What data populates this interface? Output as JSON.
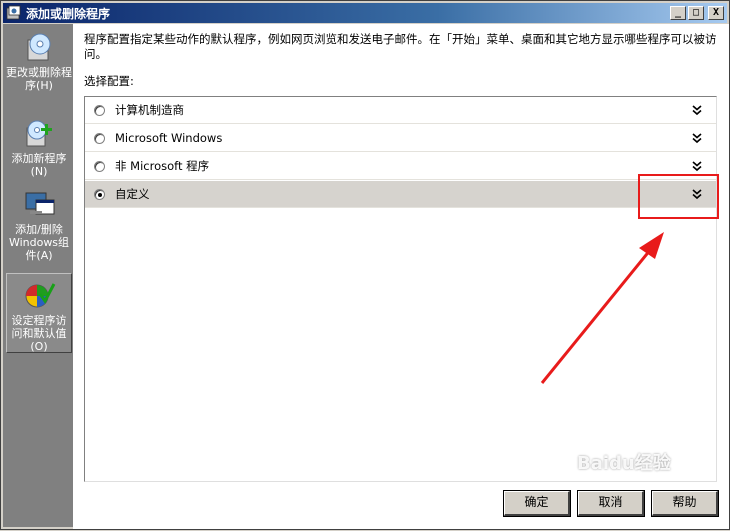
{
  "window": {
    "title": "添加或删除程序",
    "buttons": {
      "minimize": "_",
      "maximize": "□",
      "close": "X"
    }
  },
  "sidebar": {
    "items": [
      {
        "label": "更改或删除程序(H)",
        "icon": "cd-box-icon",
        "active": false
      },
      {
        "label": "添加新程序(N)",
        "icon": "add-program-icon",
        "active": false
      },
      {
        "label": "添加/删除Windows组件(A)",
        "icon": "windows-components-icon",
        "active": false
      },
      {
        "label": "设定程序访问和默认值(O)",
        "icon": "defaults-check-icon",
        "active": true
      }
    ]
  },
  "main": {
    "description": "程序配置指定某些动作的默认程序，例如网页浏览和发送电子邮件。在「开始」菜单、桌面和其它地方显示哪些程序可以被访问。",
    "config_label": "选择配置:",
    "configurations": [
      {
        "label": "计算机制造商",
        "checked": false
      },
      {
        "label": "Microsoft Windows",
        "checked": false
      },
      {
        "label": "非 Microsoft 程序",
        "checked": false
      },
      {
        "label": "自定义",
        "checked": true
      }
    ]
  },
  "footer": {
    "ok": "确定",
    "cancel": "取消",
    "help": "帮助"
  },
  "overlay": {
    "watermark": "Baidu经验"
  },
  "colors": {
    "titlebar_start": "#0a246a",
    "sidebar": "#808080",
    "selected_row": "#d6d3ce",
    "annotation": "#e81b1b"
  }
}
